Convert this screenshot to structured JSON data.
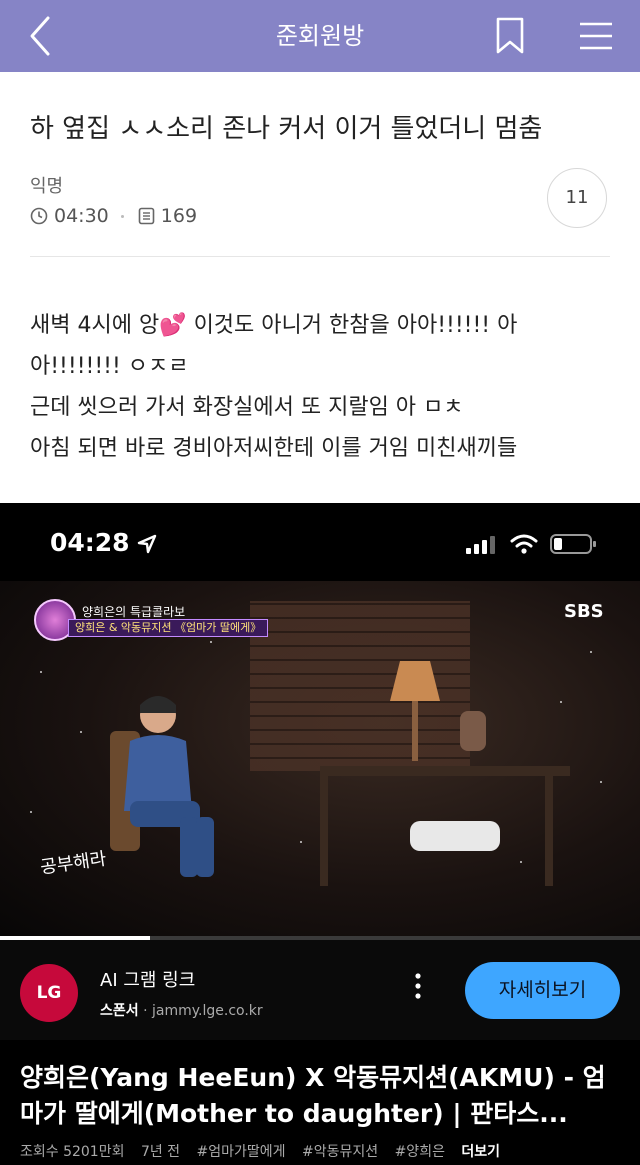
{
  "header": {
    "title": "준회원방",
    "bg_color": "#8684c6"
  },
  "post": {
    "title": "하 옆집 ㅅㅅ소리 존나 커서 이거 틀었더니 멈춤",
    "author": "익명",
    "time": "04:30",
    "views": "169",
    "comments": "11",
    "body_lines": [
      "새벽 4시에 앙💕 이것도 아니거 한참을 아아!!!!!! 아",
      "아!!!!!!!! ㅇㅈㄹ",
      "근데 씻으러 가서 화장실에서 또 지랄임 아 ㅁㅊ",
      "아침 되면 바로 경비아저씨한테 이를 거임 미친새끼들"
    ]
  },
  "screenshot": {
    "status_time": "04:28",
    "video": {
      "broadcaster": "SBS",
      "caption_line1": "양희은의 특급콜라보",
      "caption_line2": "양희은 & 악동뮤지션 《엄마가 딸에게》",
      "handwritten_caption": "공부해라",
      "progress": 0.235
    },
    "ad": {
      "logo_text": "LG",
      "title": "AI 그램 링크",
      "sponsor_label": "스폰서",
      "domain": "jammy.lge.co.kr",
      "cta": "자세히보기",
      "cta_color": "#3ea6ff"
    },
    "video_title": "양희은(Yang HeeEun) X 악동뮤지션(AKMU) - 엄마가 딸에게(Mother to daughter) | 판타스...",
    "meta": [
      "조회수 5201만회",
      "7년 전",
      "#엄마가딸에게",
      "#악동뮤지션",
      "#양희은"
    ],
    "meta_more": "더보기"
  }
}
